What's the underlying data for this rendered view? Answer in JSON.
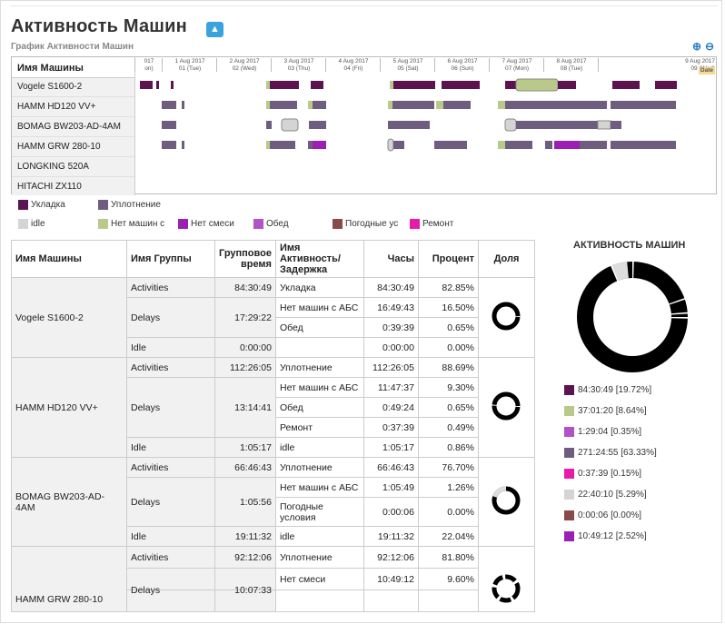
{
  "header": {
    "title": "Активность Машин",
    "collapse_icon": "chevron-up-icon",
    "subtitle": "График Активности Машин",
    "zoom_in_icon": "zoom-in-icon",
    "zoom_out_icon": "zoom-out-icon"
  },
  "gantt": {
    "names_header": "Имя Машины",
    "machines": [
      "Vogele S1600-2",
      "HAMM HD120 VV+",
      "BOMAG BW203-AD-4AM",
      "HAMM GRW 280-10",
      "LONGKING 520A",
      "HITACHI ZX110"
    ],
    "dates": [
      {
        "d": "017",
        "w": "on)"
      },
      {
        "d": "1 Aug 2017",
        "w": "01 (Tue)"
      },
      {
        "d": "2 Aug 2017",
        "w": "02 (Wed)"
      },
      {
        "d": "3 Aug 2017",
        "w": "03 (Thu)"
      },
      {
        "d": "4 Aug 2017",
        "w": "04 (Fri)"
      },
      {
        "d": "5 Aug 2017",
        "w": "05 (Sat)"
      },
      {
        "d": "6 Aug 2017",
        "w": "06 (Sun)"
      },
      {
        "d": "7 Aug 2017",
        "w": "07 (Mon)"
      },
      {
        "d": "8 Aug 2017",
        "w": "08 (Tue)"
      },
      {
        "d": "9 Aug 2017",
        "w": "09 (Wed)"
      }
    ],
    "date_flag": "Date"
  },
  "legend": [
    {
      "label": "Укладка",
      "color": "#5c1450"
    },
    {
      "label": "Уплотнение",
      "color": "#6e5d7e"
    },
    {
      "label": "idle",
      "color": "#d4d4d4"
    },
    {
      "label": "Нет машин с",
      "color": "#b9c98a"
    },
    {
      "label": "Нет смеси",
      "color": "#9c1fb4"
    },
    {
      "label": "Обед",
      "color": "#b252c8"
    },
    {
      "label": "Погодные ус",
      "color": "#8a4a4a"
    },
    {
      "label": "Ремонт",
      "color": "#e91aa8"
    }
  ],
  "table": {
    "headers": [
      "Имя Машины",
      "Имя Группы",
      "Групповое время",
      "Имя Активность/ Задержка",
      "Часы",
      "Процент",
      "Доля"
    ],
    "machines": [
      {
        "name": "Vogele S1600-2",
        "groups": [
          {
            "name": "Activities",
            "time": "84:30:49",
            "items": [
              {
                "act": "Укладка",
                "hours": "84:30:49",
                "pct": "82.85%"
              }
            ]
          },
          {
            "name": "Delays",
            "time": "17:29:22",
            "items": [
              {
                "act": "Нет машин с АБС",
                "hours": "16:49:43",
                "pct": "16.50%"
              },
              {
                "act": "Обед",
                "hours": "0:39:39",
                "pct": "0.65%"
              }
            ]
          },
          {
            "name": "Idle",
            "time": "0:00:00",
            "items": [
              {
                "act": "",
                "hours": "0:00:00",
                "pct": "0.00%"
              }
            ]
          }
        ]
      },
      {
        "name": "HAMM HD120 VV+",
        "groups": [
          {
            "name": "Activities",
            "time": "112:26:05",
            "items": [
              {
                "act": "Уплотнение",
                "hours": "112:26:05",
                "pct": "88.69%"
              }
            ]
          },
          {
            "name": "Delays",
            "time": "13:14:41",
            "items": [
              {
                "act": "Нет машин с АБС",
                "hours": "11:47:37",
                "pct": "9.30%"
              },
              {
                "act": "Обед",
                "hours": "0:49:24",
                "pct": "0.65%"
              },
              {
                "act": "Ремонт",
                "hours": "0:37:39",
                "pct": "0.49%"
              }
            ]
          },
          {
            "name": "Idle",
            "time": "1:05:17",
            "items": [
              {
                "act": "idle",
                "hours": "1:05:17",
                "pct": "0.86%"
              }
            ]
          }
        ]
      },
      {
        "name": "BOMAG BW203-AD-4AM",
        "groups": [
          {
            "name": "Activities",
            "time": "66:46:43",
            "items": [
              {
                "act": "Уплотнение",
                "hours": "66:46:43",
                "pct": "76.70%"
              }
            ]
          },
          {
            "name": "Delays",
            "time": "1:05:56",
            "items": [
              {
                "act": "Нет машин с АБС",
                "hours": "1:05:49",
                "pct": "1.26%"
              },
              {
                "act": "Погодные условия",
                "hours": "0:00:06",
                "pct": "0.00%"
              }
            ]
          },
          {
            "name": "Idle",
            "time": "19:11:32",
            "items": [
              {
                "act": "idle",
                "hours": "19:11:32",
                "pct": "22.04%"
              }
            ]
          }
        ]
      },
      {
        "name": "HAMM GRW 280-10",
        "groups": [
          {
            "name": "Activities",
            "time": "92:12:06",
            "items": [
              {
                "act": "Уплотнение",
                "hours": "92:12:06",
                "pct": "81.80%"
              }
            ]
          },
          {
            "name": "Delays",
            "time": "10:07:33",
            "items": [
              {
                "act": "Нет смеси",
                "hours": "10:49:12",
                "pct": "9.60%"
              }
            ]
          }
        ]
      }
    ]
  },
  "right_panel": {
    "title": "АКТИВНОСТЬ МАШИН",
    "legend": [
      {
        "label": "84:30:49 [19.72%]",
        "color": "#5c1450"
      },
      {
        "label": "37:01:20 [8.64%]",
        "color": "#b9c98a"
      },
      {
        "label": "1:29:04 [0.35%]",
        "color": "#b252c8"
      },
      {
        "label": "271:24:55 [63.33%]",
        "color": "#6e5d7e"
      },
      {
        "label": "0:37:39 [0.15%]",
        "color": "#e91aa8"
      },
      {
        "label": "22:40:10 [5.29%]",
        "color": "#d4d4d4"
      },
      {
        "label": "0:00:06 [0.00%]",
        "color": "#8a4a4a"
      },
      {
        "label": "10:49:12 [2.52%]",
        "color": "#9c1fb4"
      }
    ]
  }
}
